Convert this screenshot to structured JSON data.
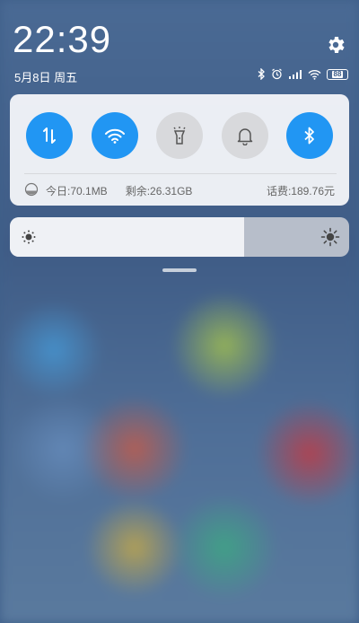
{
  "status": {
    "time": "22:39",
    "date": "5月8日 周五",
    "battery_level": "88"
  },
  "quick_toggles": [
    {
      "id": "mobile-data",
      "icon": "data-arrows-icon",
      "on": true
    },
    {
      "id": "wifi",
      "icon": "wifi-icon",
      "on": true
    },
    {
      "id": "flashlight",
      "icon": "flashlight-icon",
      "on": false
    },
    {
      "id": "ringer",
      "icon": "bell-icon",
      "on": false
    },
    {
      "id": "bluetooth",
      "icon": "bluetooth-icon",
      "on": true
    }
  ],
  "usage": {
    "today": "今日:70.1MB",
    "remaining": "剩余:26.31GB",
    "balance": "话费:189.76元"
  },
  "brightness": {
    "level_fraction": 0.69
  },
  "colors": {
    "accent": "#2196f3",
    "toggle_off": "#d8d9dc",
    "panel": "#f2f4f8"
  }
}
